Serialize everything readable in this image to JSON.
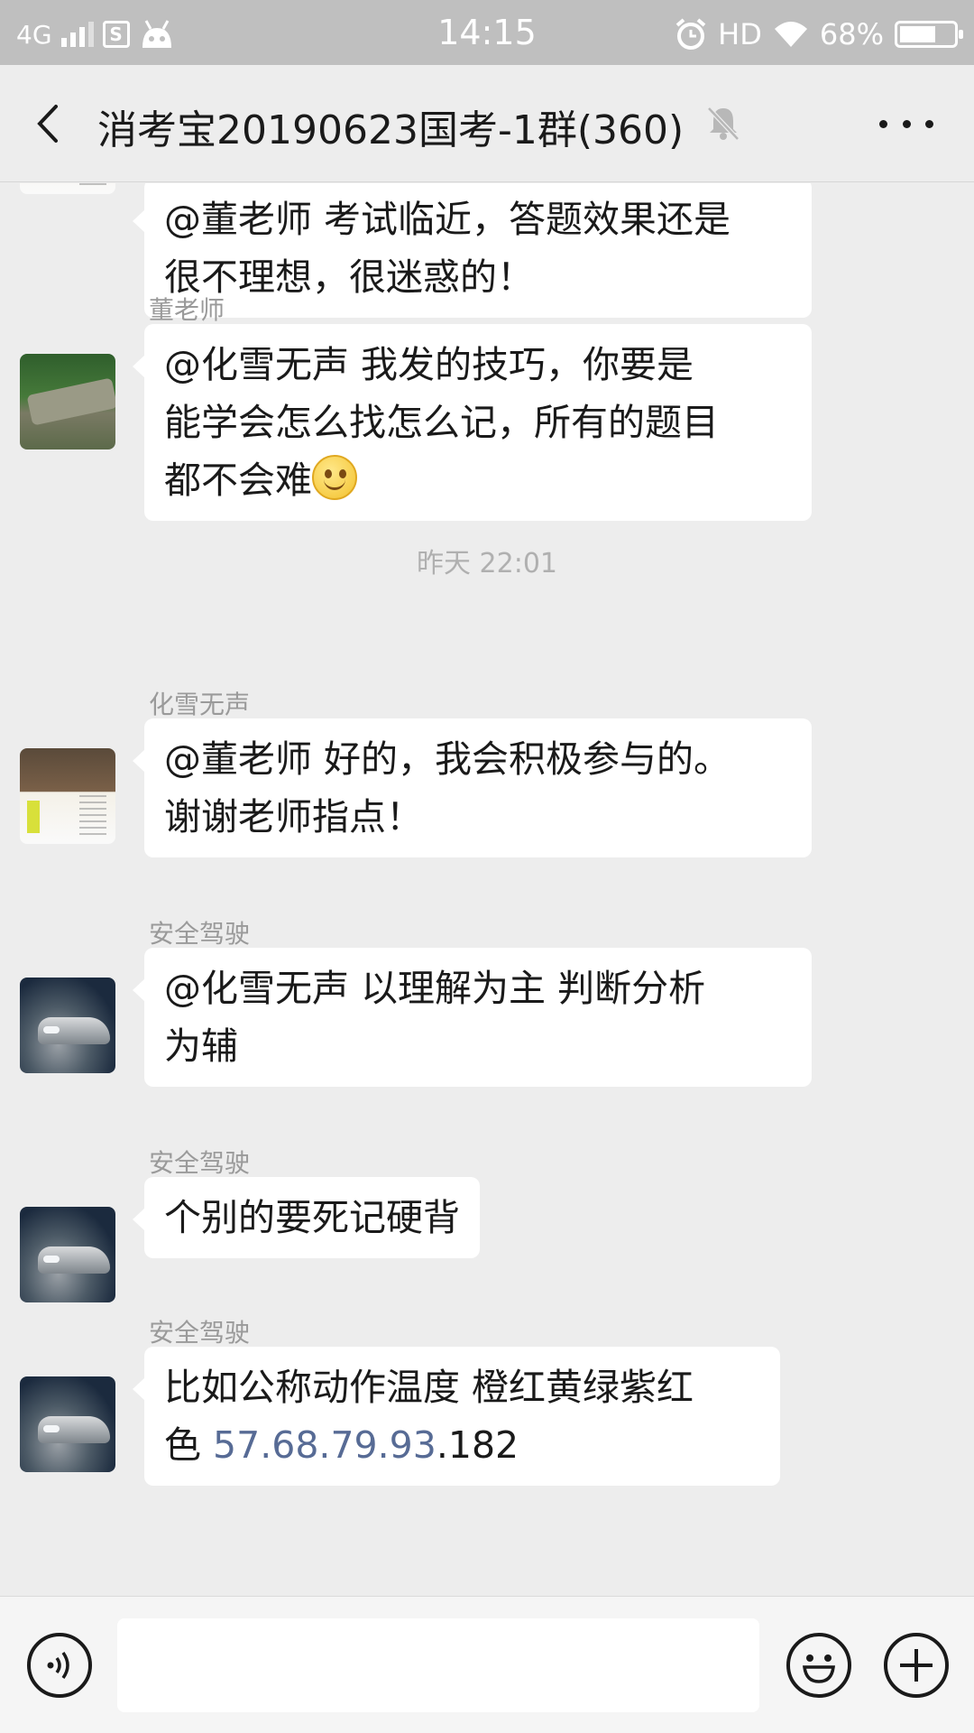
{
  "status_bar": {
    "network": "4G",
    "time": "14:15",
    "hd": "HD",
    "battery": "68%",
    "battery_level": 0.68
  },
  "nav": {
    "title": "消考宝20190623国考-1群(360)"
  },
  "messages": [
    {
      "sender": "",
      "avatar": "student-avatar",
      "lines": [
        "@董老师  考试临近，答题效果还是",
        "很不理想，很迷惑的！"
      ]
    },
    {
      "sender": "董老师",
      "avatar": "teacher-avatar",
      "lines": [
        "@化雪无声    我发的技巧，你要是",
        "能学会怎么找怎么记，所有的题目",
        "都不会难"
      ]
    },
    {
      "time_separator": "昨天 22:01"
    },
    {
      "sender": "化雪无声",
      "avatar": "student-avatar",
      "lines": [
        "@董老师  好的，我会积极参与的。",
        "谢谢老师指点！"
      ]
    },
    {
      "sender": "安全驾驶",
      "avatar": "car-avatar",
      "lines": [
        "@化雪无声  以理解为主  判断分析",
        "为辅"
      ]
    },
    {
      "sender": "安全驾驶",
      "avatar": "car-avatar",
      "lines": [
        "个别的要死记硬背"
      ]
    },
    {
      "sender": "安全驾驶",
      "avatar": "car-avatar",
      "line1": "比如公称动作温度 橙红黄绿紫红",
      "line2_prefix": "色 ",
      "line2_link": "57.68.79.93",
      "line2_suffix": ".182"
    }
  ],
  "colors": {
    "link": "#576b95",
    "chat_background": "#ededed",
    "bubble": "#ffffff",
    "status_bar": "#bfbfbf"
  },
  "icons": {
    "back": "chevron-left-icon",
    "mute": "bell-off-icon",
    "more": "more-dots-icon",
    "voice": "voice-icon",
    "emoji": "emoji-icon",
    "plus": "plus-icon"
  }
}
